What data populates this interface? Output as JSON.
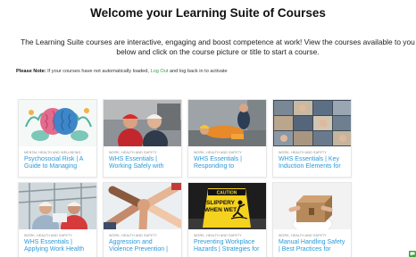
{
  "header": {
    "title": "Welcome your Learning Suite of Courses",
    "intro": "The Learning Suite courses are interactive, engaging and boost competence at work! View the courses available to you below and click on the course picture or title to start a course."
  },
  "note": {
    "label": "Please Note:",
    "text_before": " If your courses have not automatically loaded, ",
    "link": "Log Out",
    "text_after": " and log back in to activate"
  },
  "courses": [
    {
      "category": "MENTAL HEALTH AND WELLBEING",
      "title": "Psychosocial Risk | A Guide to Managing",
      "image": "brain-illustration"
    },
    {
      "category": "WORK, HEALTH AND SAFETY",
      "title": "WHS Essentials | Working Safely with",
      "image": "workers-hardhats"
    },
    {
      "category": "WORK, HEALTH AND SAFETY",
      "title": "WHS Essentials | Responding to",
      "image": "injured-worker"
    },
    {
      "category": "WORK, HEALTH AND SAFETY",
      "title": "WHS Essentials | Key Induction Elements for",
      "image": "induction-collage"
    },
    {
      "category": "WORK, HEALTH AND SAFETY",
      "title": "WHS Essentials | Applying Work Health",
      "image": "construction-workers"
    },
    {
      "category": "WORK, HEALTH AND SAFETY",
      "title": "Aggression and Violence Prevention |",
      "image": "hands-stacked"
    },
    {
      "category": "WORK, HEALTH AND SAFETY",
      "title": "Preventing Workplace Hazards | Strategies for",
      "image": "slippery-sign",
      "sign_line1": "CAUTION",
      "sign_line2": "SLIPPERY",
      "sign_line3": "WHEN WET"
    },
    {
      "category": "WORK, HEALTH AND SAFETY",
      "title": "Manual Handling Safety | Best Practices for",
      "image": "carrying-box"
    }
  ],
  "chat_widget": {
    "icon": "chat-icon",
    "color": "#37a637"
  }
}
